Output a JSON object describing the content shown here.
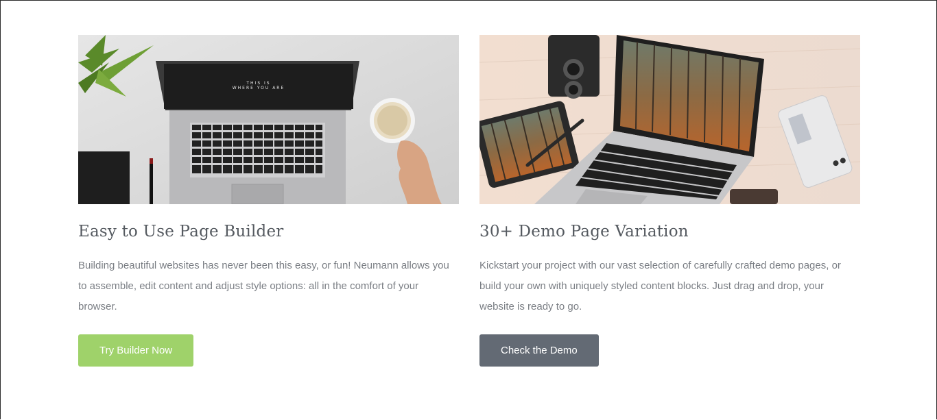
{
  "features": [
    {
      "title": "Easy to Use Page Builder",
      "description": "Building beautiful websites has never been this easy, or fun! Neumann allows you to assemble, edit content and adjust style options: all in the comfort of your browser.",
      "button_label": "Try Builder Now",
      "button_color": "#9fd26a",
      "image": "laptop-desk-photo",
      "screen_text": "THIS IS WHERE YOU ARE"
    },
    {
      "title": "30+ Demo Page Variation",
      "description": "Kickstart your project with our vast selection of carefully crafted demo pages, or build your own with uniquely styled content blocks. Just drag and drop, your website is ready to go.",
      "button_label": "Check the Demo",
      "button_color": "#636a74",
      "image": "devices-forest-photo"
    }
  ]
}
